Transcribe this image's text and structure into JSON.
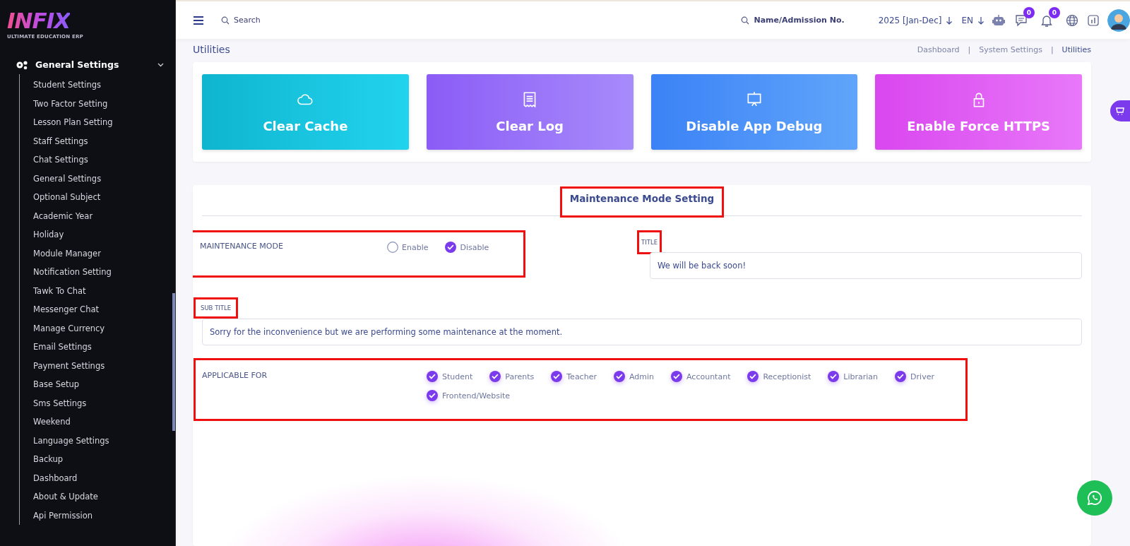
{
  "logo": {
    "wordmark": "INFIX",
    "tagline": "ULTIMATE EDUCATION ERP"
  },
  "sidebar": {
    "group": {
      "label": "General Settings",
      "expanded": true
    },
    "items": [
      {
        "label": "Student Settings"
      },
      {
        "label": "Two Factor Setting"
      },
      {
        "label": "Lesson Plan Setting"
      },
      {
        "label": "Staff Settings"
      },
      {
        "label": "Chat Settings"
      },
      {
        "label": "General Settings"
      },
      {
        "label": "Optional Subject"
      },
      {
        "label": "Academic Year"
      },
      {
        "label": "Holiday"
      },
      {
        "label": "Module Manager"
      },
      {
        "label": "Notification Setting"
      },
      {
        "label": "Tawk To Chat"
      },
      {
        "label": "Messenger Chat"
      },
      {
        "label": "Manage Currency"
      },
      {
        "label": "Email Settings"
      },
      {
        "label": "Payment Settings"
      },
      {
        "label": "Base Setup"
      },
      {
        "label": "Sms Settings"
      },
      {
        "label": "Weekend"
      },
      {
        "label": "Language Settings"
      },
      {
        "label": "Backup"
      },
      {
        "label": "Dashboard"
      },
      {
        "label": "About & Update"
      },
      {
        "label": "Api Permission"
      }
    ]
  },
  "topbar": {
    "search_placeholder": "Search",
    "student_search_placeholder": "Name/Admission No.",
    "session": "2025 [Jan-Dec]",
    "language": "EN",
    "chat_badge": "0",
    "notification_badge": "0"
  },
  "page": {
    "title": "Utilities",
    "separator": "|",
    "breadcrumb": [
      {
        "label": "Dashboard",
        "selected": false
      },
      {
        "label": "System Settings",
        "selected": false
      },
      {
        "label": "Utilities",
        "selected": true
      }
    ]
  },
  "actions": [
    {
      "label": "Clear Cache",
      "kind": "cache"
    },
    {
      "label": "Clear Log",
      "kind": "log"
    },
    {
      "label": "Disable App Debug",
      "kind": "debug"
    },
    {
      "label": "Enable Force HTTPS",
      "kind": "https"
    }
  ],
  "maintenance": {
    "heading": "Maintenance Mode Setting",
    "heading_highlighted": true,
    "mode_label": "MAINTENANCE MODE",
    "mode_highlighted": true,
    "options": [
      {
        "label": "Enable",
        "selected": false
      },
      {
        "label": "Disable",
        "selected": true
      }
    ],
    "title_label": "TITLE",
    "title_label_highlighted": true,
    "title_value": "We will be back soon!",
    "subtitle_label": "SUB TITLE",
    "subtitle_label_highlighted": true,
    "subtitle_value": "Sorry for the inconvenience but we are performing some maintenance at the moment.",
    "applicable_label": "APPLICABLE FOR",
    "applicable_highlighted": true,
    "roles": [
      {
        "label": "Student",
        "checked": true
      },
      {
        "label": "Parents",
        "checked": true
      },
      {
        "label": "Teacher",
        "checked": true
      },
      {
        "label": "Admin",
        "checked": true
      },
      {
        "label": "Accountant",
        "checked": true
      },
      {
        "label": "Receptionist",
        "checked": true
      },
      {
        "label": "Librarian",
        "checked": true
      },
      {
        "label": "Driver",
        "checked": true
      },
      {
        "label": "Frontend/Website",
        "checked": true
      }
    ]
  }
}
